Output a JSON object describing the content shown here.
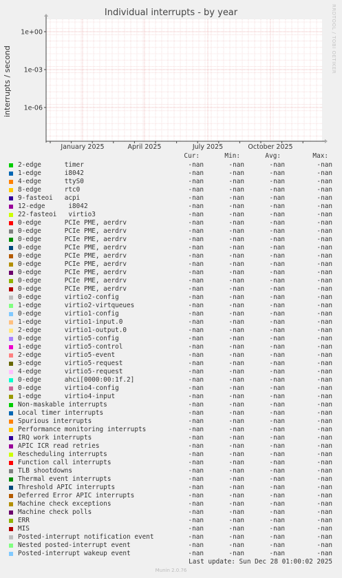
{
  "title": "Individual interrupts - by year",
  "side_text": "RRDTOOL / TOBI OETIKER",
  "chart_data": {
    "type": "line",
    "title": "Individual interrupts - by year",
    "ylabel": "interrupts / second",
    "yscale": "log",
    "yticks": [
      "1e+00",
      "1e-03",
      "1e-06"
    ],
    "xticks": [
      "January 2025",
      "April 2025",
      "July 2025",
      "October 2025"
    ],
    "grid": true,
    "series_values": "no data (all -nan)"
  },
  "columns": [
    "Cur:",
    "Min:",
    "Avg:",
    "Max:"
  ],
  "series": [
    {
      "name": "2-edge      timer",
      "color": "#00cc00",
      "values": [
        "-nan",
        "-nan",
        "-nan",
        "-nan"
      ]
    },
    {
      "name": "1-edge      i8042",
      "color": "#0066b3",
      "values": [
        "-nan",
        "-nan",
        "-nan",
        "-nan"
      ]
    },
    {
      "name": "4-edge      ttyS0",
      "color": "#ff8000",
      "values": [
        "-nan",
        "-nan",
        "-nan",
        "-nan"
      ]
    },
    {
      "name": "8-edge      rtc0",
      "color": "#ffcc00",
      "values": [
        "-nan",
        "-nan",
        "-nan",
        "-nan"
      ]
    },
    {
      "name": "9-fasteoi   acpi",
      "color": "#330099",
      "values": [
        "-nan",
        "-nan",
        "-nan",
        "-nan"
      ]
    },
    {
      "name": "12-edge      i8042",
      "color": "#990099",
      "values": [
        "-nan",
        "-nan",
        "-nan",
        "-nan"
      ]
    },
    {
      "name": "22-fasteoi   virtio3",
      "color": "#ccff00",
      "values": [
        "-nan",
        "-nan",
        "-nan",
        "-nan"
      ]
    },
    {
      "name": "0-edge      PCIe PME, aerdrv",
      "color": "#ff0000",
      "values": [
        "-nan",
        "-nan",
        "-nan",
        "-nan"
      ]
    },
    {
      "name": "0-edge      PCIe PME, aerdrv",
      "color": "#808080",
      "values": [
        "-nan",
        "-nan",
        "-nan",
        "-nan"
      ]
    },
    {
      "name": "0-edge      PCIe PME, aerdrv",
      "color": "#008f00",
      "values": [
        "-nan",
        "-nan",
        "-nan",
        "-nan"
      ]
    },
    {
      "name": "0-edge      PCIe PME, aerdrv",
      "color": "#00487d",
      "values": [
        "-nan",
        "-nan",
        "-nan",
        "-nan"
      ]
    },
    {
      "name": "0-edge      PCIe PME, aerdrv",
      "color": "#b35a00",
      "values": [
        "-nan",
        "-nan",
        "-nan",
        "-nan"
      ]
    },
    {
      "name": "0-edge      PCIe PME, aerdrv",
      "color": "#b38f00",
      "values": [
        "-nan",
        "-nan",
        "-nan",
        "-nan"
      ]
    },
    {
      "name": "0-edge      PCIe PME, aerdrv",
      "color": "#6b006b",
      "values": [
        "-nan",
        "-nan",
        "-nan",
        "-nan"
      ]
    },
    {
      "name": "0-edge      PCIe PME, aerdrv",
      "color": "#8fb300",
      "values": [
        "-nan",
        "-nan",
        "-nan",
        "-nan"
      ]
    },
    {
      "name": "0-edge      PCIe PME, aerdrv",
      "color": "#b30000",
      "values": [
        "-nan",
        "-nan",
        "-nan",
        "-nan"
      ]
    },
    {
      "name": "0-edge      virtio2-config",
      "color": "#bebebe",
      "values": [
        "-nan",
        "-nan",
        "-nan",
        "-nan"
      ]
    },
    {
      "name": "1-edge      virtio2-virtqueues",
      "color": "#80ff80",
      "values": [
        "-nan",
        "-nan",
        "-nan",
        "-nan"
      ]
    },
    {
      "name": "0-edge      virtio1-config",
      "color": "#80c9ff",
      "values": [
        "-nan",
        "-nan",
        "-nan",
        "-nan"
      ]
    },
    {
      "name": "1-edge      virtio1-input.0",
      "color": "#ffc080",
      "values": [
        "-nan",
        "-nan",
        "-nan",
        "-nan"
      ]
    },
    {
      "name": "2-edge      virtio1-output.0",
      "color": "#ffe680",
      "values": [
        "-nan",
        "-nan",
        "-nan",
        "-nan"
      ]
    },
    {
      "name": "0-edge      virtio5-config",
      "color": "#aa80ff",
      "values": [
        "-nan",
        "-nan",
        "-nan",
        "-nan"
      ]
    },
    {
      "name": "1-edge      virtio5-control",
      "color": "#ee00cc",
      "values": [
        "-nan",
        "-nan",
        "-nan",
        "-nan"
      ]
    },
    {
      "name": "2-edge      virtio5-event",
      "color": "#ff8080",
      "values": [
        "-nan",
        "-nan",
        "-nan",
        "-nan"
      ]
    },
    {
      "name": "3-edge      virtio5-request",
      "color": "#666600",
      "values": [
        "-nan",
        "-nan",
        "-nan",
        "-nan"
      ]
    },
    {
      "name": "4-edge      virtio5-request",
      "color": "#ffbfff",
      "values": [
        "-nan",
        "-nan",
        "-nan",
        "-nan"
      ]
    },
    {
      "name": "0-edge      ahci[0000:00:1f.2]",
      "color": "#00ffcc",
      "values": [
        "-nan",
        "-nan",
        "-nan",
        "-nan"
      ]
    },
    {
      "name": "0-edge      virtio4-config",
      "color": "#cc6699",
      "values": [
        "-nan",
        "-nan",
        "-nan",
        "-nan"
      ]
    },
    {
      "name": "1-edge      virtio4-input",
      "color": "#999900",
      "values": [
        "-nan",
        "-nan",
        "-nan",
        "-nan"
      ]
    },
    {
      "name": "Non-maskable interrupts",
      "color": "#00cc00",
      "values": [
        "-nan",
        "-nan",
        "-nan",
        "-nan"
      ]
    },
    {
      "name": "Local timer interrupts",
      "color": "#0066b3",
      "values": [
        "-nan",
        "-nan",
        "-nan",
        "-nan"
      ]
    },
    {
      "name": "Spurious interrupts",
      "color": "#ff8000",
      "values": [
        "-nan",
        "-nan",
        "-nan",
        "-nan"
      ]
    },
    {
      "name": "Performance monitoring interrupts",
      "color": "#ffcc00",
      "values": [
        "-nan",
        "-nan",
        "-nan",
        "-nan"
      ]
    },
    {
      "name": "IRQ work interrupts",
      "color": "#330099",
      "values": [
        "-nan",
        "-nan",
        "-nan",
        "-nan"
      ]
    },
    {
      "name": "APIC ICR read retries",
      "color": "#990099",
      "values": [
        "-nan",
        "-nan",
        "-nan",
        "-nan"
      ]
    },
    {
      "name": "Rescheduling interrupts",
      "color": "#ccff00",
      "values": [
        "-nan",
        "-nan",
        "-nan",
        "-nan"
      ]
    },
    {
      "name": "Function call interrupts",
      "color": "#ff0000",
      "values": [
        "-nan",
        "-nan",
        "-nan",
        "-nan"
      ]
    },
    {
      "name": "TLB shootdowns",
      "color": "#808080",
      "values": [
        "-nan",
        "-nan",
        "-nan",
        "-nan"
      ]
    },
    {
      "name": "Thermal event interrupts",
      "color": "#008f00",
      "values": [
        "-nan",
        "-nan",
        "-nan",
        "-nan"
      ]
    },
    {
      "name": "Threshold APIC interrupts",
      "color": "#00487d",
      "values": [
        "-nan",
        "-nan",
        "-nan",
        "-nan"
      ]
    },
    {
      "name": "Deferred Error APIC interrupts",
      "color": "#b35a00",
      "values": [
        "-nan",
        "-nan",
        "-nan",
        "-nan"
      ]
    },
    {
      "name": "Machine check exceptions",
      "color": "#b38f00",
      "values": [
        "-nan",
        "-nan",
        "-nan",
        "-nan"
      ]
    },
    {
      "name": "Machine check polls",
      "color": "#6b006b",
      "values": [
        "-nan",
        "-nan",
        "-nan",
        "-nan"
      ]
    },
    {
      "name": "ERR",
      "color": "#8fb300",
      "values": [
        "-nan",
        "-nan",
        "-nan",
        "-nan"
      ]
    },
    {
      "name": "MIS",
      "color": "#b30000",
      "values": [
        "-nan",
        "-nan",
        "-nan",
        "-nan"
      ]
    },
    {
      "name": "Posted-interrupt notification event",
      "color": "#bebebe",
      "values": [
        "-nan",
        "-nan",
        "-nan",
        "-nan"
      ]
    },
    {
      "name": "Nested posted-interrupt event",
      "color": "#80ff80",
      "values": [
        "-nan",
        "-nan",
        "-nan",
        "-nan"
      ]
    },
    {
      "name": "Posted-interrupt wakeup event",
      "color": "#80c9ff",
      "values": [
        "-nan",
        "-nan",
        "-nan",
        "-nan"
      ]
    }
  ],
  "last_update": "Last update: Sun Dec 28 01:00:02 2025",
  "footer": "Munin 2.0.76"
}
